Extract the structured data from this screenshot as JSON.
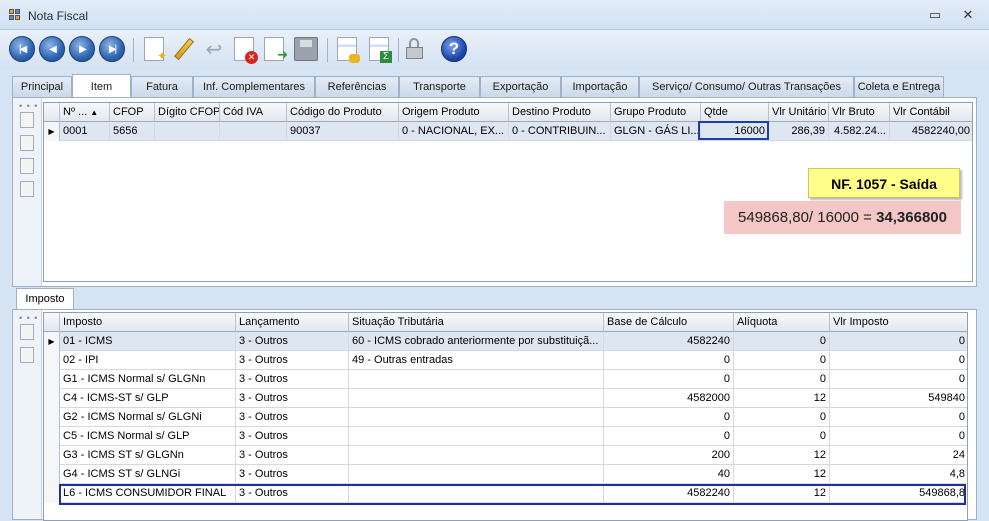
{
  "window": {
    "title": "Nota Fiscal",
    "minimize_glyph": "▭",
    "close_glyph": "✕"
  },
  "tabs": [
    "Principal",
    "Item",
    "Fatura",
    "Inf. Complementares",
    "Referências",
    "Transporte",
    "Exportação",
    "Importação",
    "Serviço/ Consumo/ Outras Transações",
    "Coleta e Entrega"
  ],
  "active_tab": "Item",
  "items_grid": {
    "columns": [
      "Nº ...",
      "CFOP",
      "Dígito CFOP",
      "Cód IVA",
      "Código do Produto",
      "Origem Produto",
      "Destino Produto",
      "Grupo Produto",
      "Qtde",
      "Vlr Unitário",
      "Vlr Bruto",
      "Vlr Contábil"
    ],
    "sort_glyph": "▲",
    "rows": [
      [
        "0001",
        "5656",
        "",
        "",
        "90037",
        "0 - NACIONAL, EX...",
        "0 - CONTRIBUIN...",
        "GLGN - GÁS LI...",
        "16000",
        "286,39",
        "4.582.24...",
        "4582240,00"
      ]
    ]
  },
  "notes": {
    "nf": "NF. 1057 - Saída",
    "calc_prefix": "549868,80/ 16000 = ",
    "calc_result": "34,366800"
  },
  "imposto_tab": "Imposto",
  "imposto_grid": {
    "columns": [
      "Imposto",
      "Lançamento",
      "Situação Tributária",
      "Base de Cálculo",
      "Alíquota",
      "Vlr Imposto"
    ],
    "rows": [
      [
        "01 - ICMS",
        "3 - Outros",
        "60 - ICMS cobrado anteriormente por substituiçã...",
        "4582240",
        "0",
        "0"
      ],
      [
        "02 - IPI",
        "3 - Outros",
        "49 - Outras entradas",
        "0",
        "0",
        "0"
      ],
      [
        "G1 - ICMS Normal s/ GLGNn",
        "3 - Outros",
        "",
        "0",
        "0",
        "0"
      ],
      [
        "C4 - ICMS-ST s/ GLP",
        "3 - Outros",
        "",
        "4582000",
        "12",
        "549840"
      ],
      [
        "G2 - ICMS Normal s/ GLGNi",
        "3 - Outros",
        "",
        "0",
        "0",
        "0"
      ],
      [
        "C5 - ICMS Normal s/ GLP",
        "3 - Outros",
        "",
        "0",
        "0",
        "0"
      ],
      [
        "G3 - ICMS ST s/ GLGNn",
        "3 - Outros",
        "",
        "200",
        "12",
        "24"
      ],
      [
        "G4 - ICMS ST s/ GLNGi",
        "3 - Outros",
        "",
        "40",
        "12",
        "4,8"
      ],
      [
        "L6 - ICMS CONSUMIDOR FINAL",
        "3 - Outros",
        "",
        "4582240",
        "12",
        "549868,8"
      ]
    ]
  },
  "icons": {
    "toolbar": [
      "first-record-icon",
      "prev-record-icon",
      "next-record-icon",
      "last-record-icon",
      "new-icon",
      "edit-icon",
      "undo-icon",
      "delete-icon",
      "confirm-icon",
      "save-icon",
      "report-icon",
      "calculate-icon",
      "lock-icon",
      "help-icon"
    ]
  },
  "help_glyph": "?",
  "row_indicator": "▶"
}
